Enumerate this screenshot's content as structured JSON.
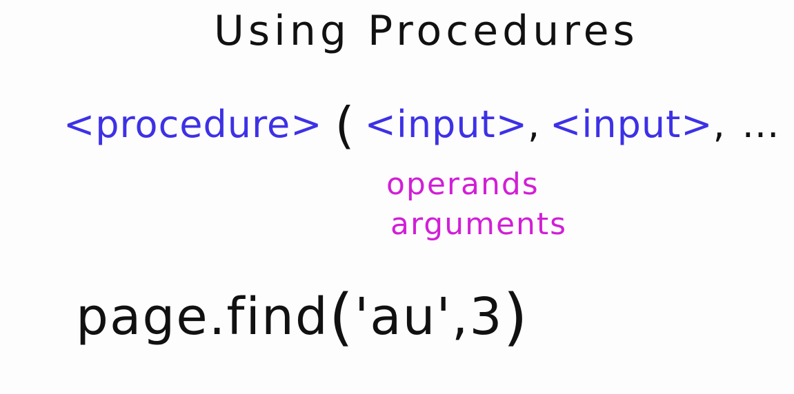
{
  "colors": {
    "ink": "#111111",
    "syntax": "#3d31e6",
    "terms": "#d11fd6",
    "background": "#fdfdfd"
  },
  "title": "Using Procedures",
  "syntax": {
    "procedure": "<procedure>",
    "open_paren": "(",
    "input_1": "<input>",
    "comma_1": ",",
    "input_2": "<input>",
    "comma_2": ",",
    "ellipsis": "...",
    "close_paren": ")"
  },
  "terms": {
    "operands": "operands",
    "arguments": "arguments"
  },
  "example": {
    "object": "page",
    "dot": ".",
    "method": "find",
    "open_paren": "(",
    "arg_1": "'au'",
    "comma": ",",
    "arg_2": "3",
    "close_paren": ")"
  }
}
